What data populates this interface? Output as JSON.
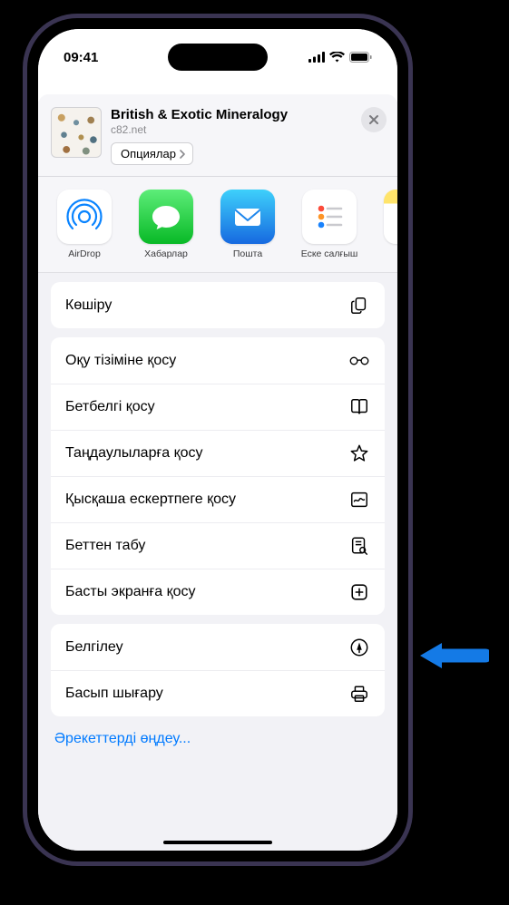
{
  "status": {
    "time": "09:41"
  },
  "header": {
    "title": "British & Exotic Mineralogy",
    "subtitle": "c82.net",
    "options_label": "Опциялар"
  },
  "apps": [
    {
      "label": "AirDrop"
    },
    {
      "label": "Хабарлар"
    },
    {
      "label": "Пошта"
    },
    {
      "label": "Еске салғыш"
    },
    {
      "label": ""
    }
  ],
  "actions": {
    "group1": [
      {
        "label": "Көшіру",
        "icon": "copy"
      }
    ],
    "group2": [
      {
        "label": "Оқу тізіміне қосу",
        "icon": "glasses"
      },
      {
        "label": "Бетбелгі қосу",
        "icon": "book"
      },
      {
        "label": "Таңдаулыларға қосу",
        "icon": "star"
      },
      {
        "label": "Қысқаша ескертпеге қосу",
        "icon": "quicknote"
      },
      {
        "label": "Беттен табу",
        "icon": "find"
      },
      {
        "label": "Басты экранға қосу",
        "icon": "addscreen"
      }
    ],
    "group3": [
      {
        "label": "Белгілеу",
        "icon": "markup"
      },
      {
        "label": "Басып шығару",
        "icon": "print"
      }
    ]
  },
  "edit_actions_label": "Әрекеттерді өңдеу..."
}
